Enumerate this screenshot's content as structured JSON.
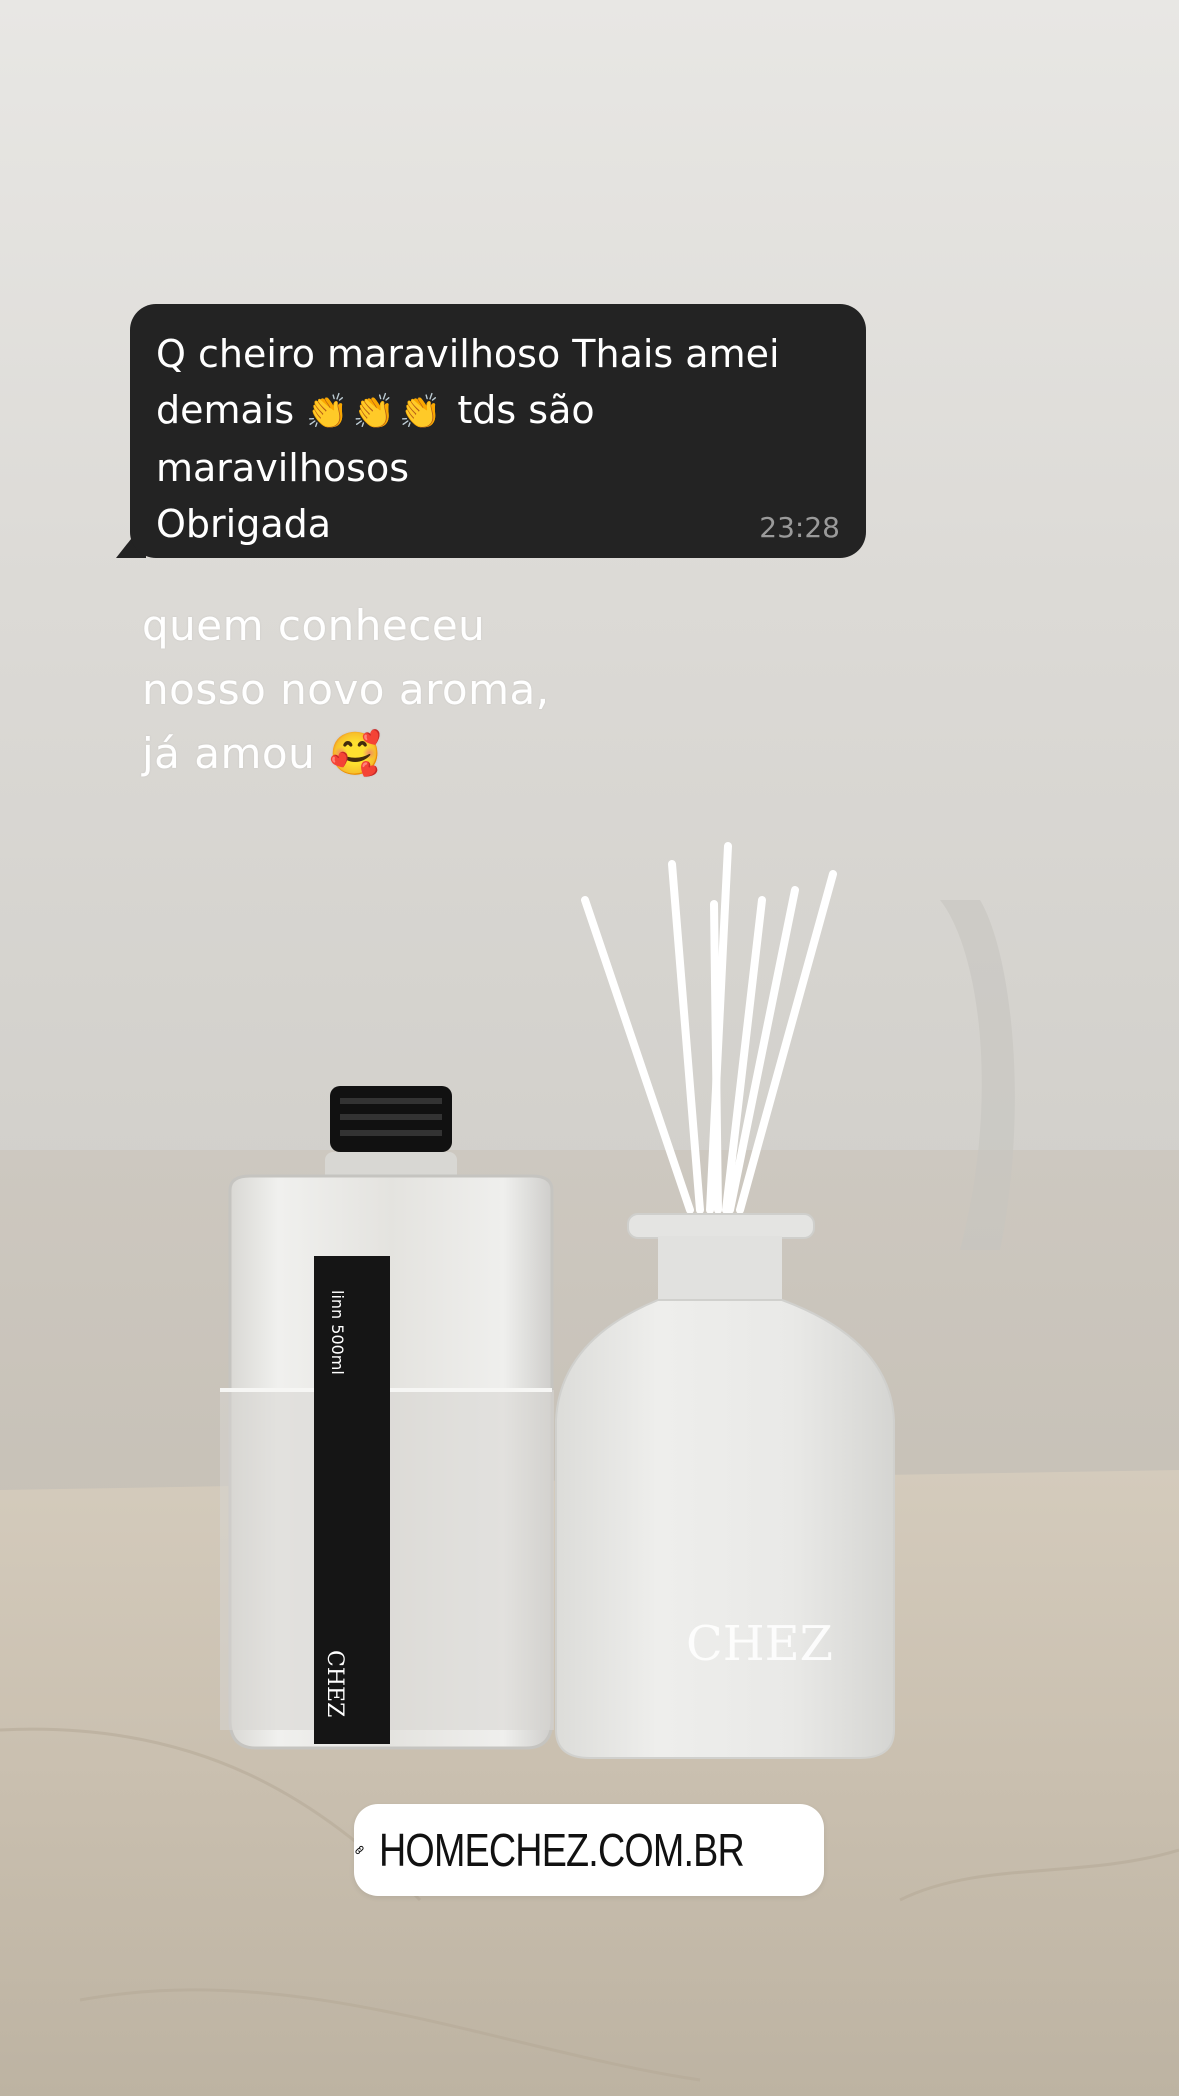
{
  "story": {
    "message": {
      "lines": [
        "Q cheiro maravilhoso Thais amei",
        "demais",
        "tds são",
        "maravilhosos",
        "Obrigada"
      ],
      "emoji": [
        "👏",
        "👏",
        "👏"
      ],
      "time": "23:28"
    },
    "caption": {
      "lines": [
        "quem conheceu",
        "nosso novo aroma,",
        "já amou"
      ],
      "emoji": "🥰"
    },
    "product": {
      "refill_label_brand": "linn",
      "refill_label_volume": "500ml",
      "refill_label_logo": "CHEZ",
      "diffuser_logo": "CHEZ"
    },
    "link_sticker": {
      "icon": "link-icon",
      "text": "HOMECHEZ.COM.BR"
    }
  },
  "colors": {
    "bubble_bg": "#232323",
    "bubble_text": "#ffffff",
    "timestamp": "#9a9a9a",
    "sticker_bg": "#ffffff",
    "sticker_text": "#111111"
  }
}
